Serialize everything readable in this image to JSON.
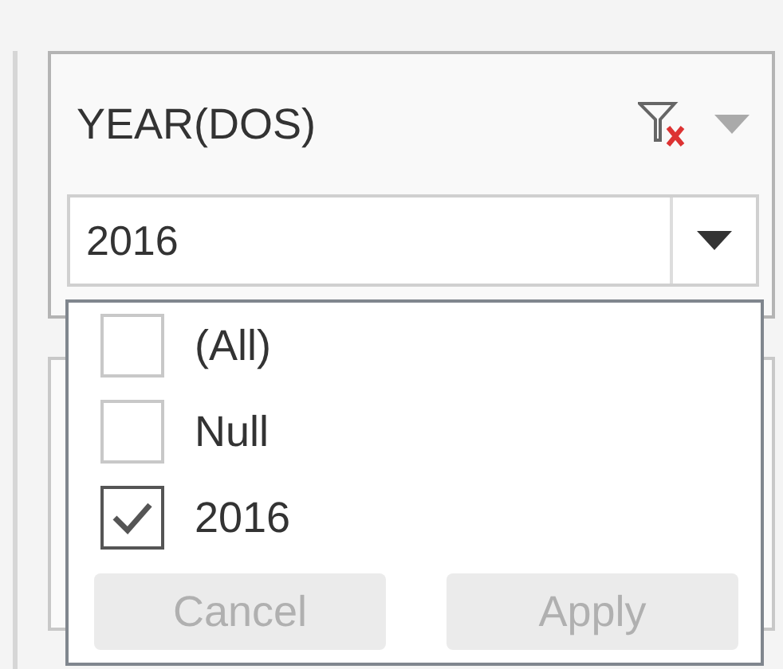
{
  "filter": {
    "title": "YEAR(DOS)",
    "value": "2016"
  },
  "dropdown": {
    "items": [
      {
        "label": "(All)",
        "checked": false
      },
      {
        "label": "Null",
        "checked": false
      },
      {
        "label": "2016",
        "checked": true
      }
    ],
    "buttons": [
      {
        "label": "Cancel",
        "disabled": true
      },
      {
        "label": "Apply",
        "disabled": true
      }
    ]
  }
}
